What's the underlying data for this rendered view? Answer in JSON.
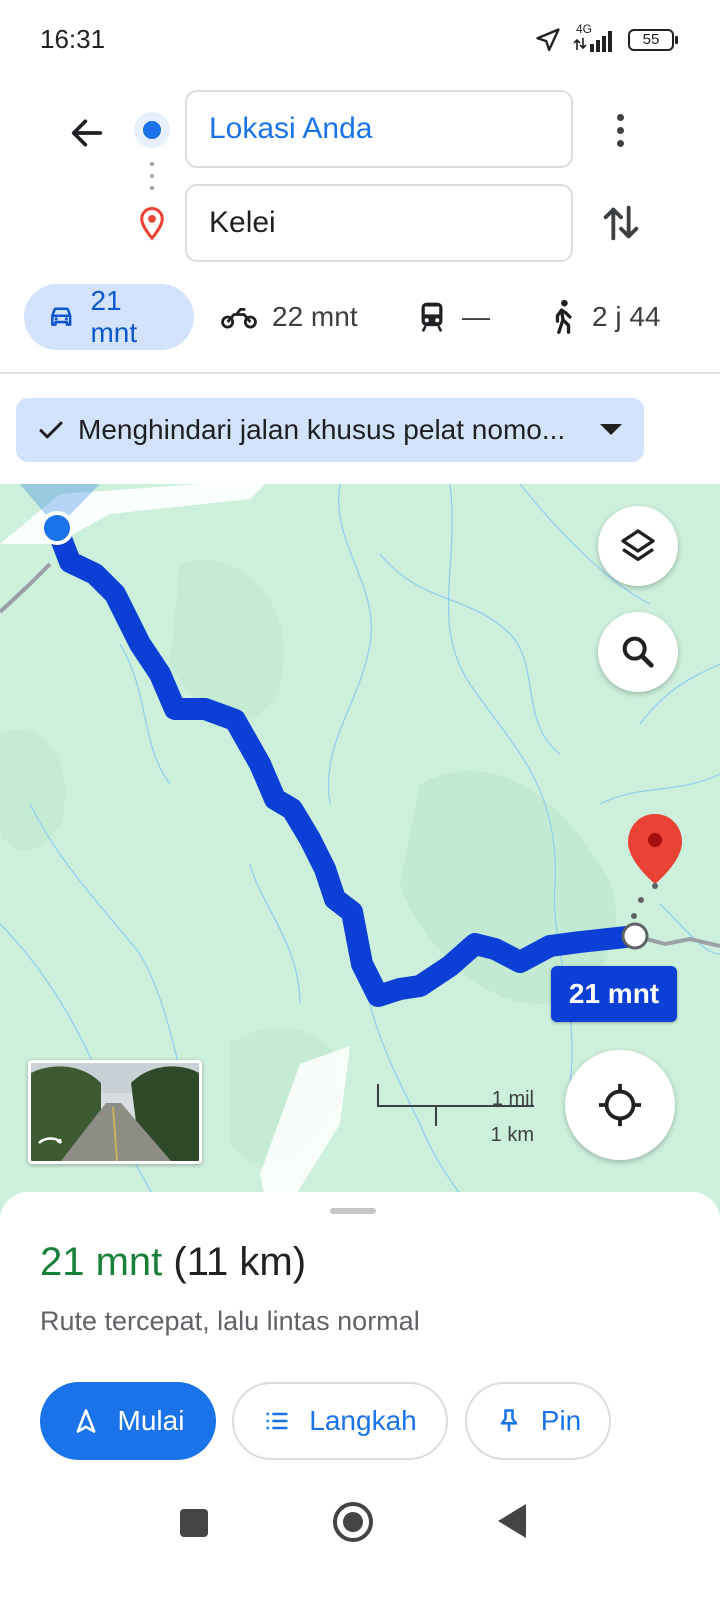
{
  "status_bar": {
    "time": "16:31",
    "network": "4G",
    "battery": "55"
  },
  "search": {
    "origin": "Lokasi Anda",
    "destination": "Kelei"
  },
  "travel_modes": [
    {
      "mode": "car",
      "icon": "car-icon",
      "value": "21 mnt",
      "active": true
    },
    {
      "mode": "motorcycle",
      "icon": "motorcycle-icon",
      "value": "22 mnt",
      "active": false
    },
    {
      "mode": "transit",
      "icon": "train-icon",
      "value": "—",
      "active": false
    },
    {
      "mode": "walk",
      "icon": "walking-icon",
      "value": "2 j 44",
      "active": false
    }
  ],
  "filter_chip": {
    "label": "Menghindari jalan khusus pelat nomo..."
  },
  "map": {
    "eta_label": "21 mnt",
    "scale_mi": "1 mil",
    "scale_km": "1 km",
    "route_color": "#0b3fd6"
  },
  "sheet": {
    "time": "21 mnt",
    "distance": "(11 km)",
    "description": "Rute tercepat, lalu lintas normal",
    "buttons": {
      "start": "Mulai",
      "steps": "Langkah",
      "pin": "Pin"
    }
  },
  "colors": {
    "accent": "#1a73e8",
    "eta_green": "#188038",
    "map_green": "#cdf0dc",
    "destination_red": "#ea4335"
  }
}
